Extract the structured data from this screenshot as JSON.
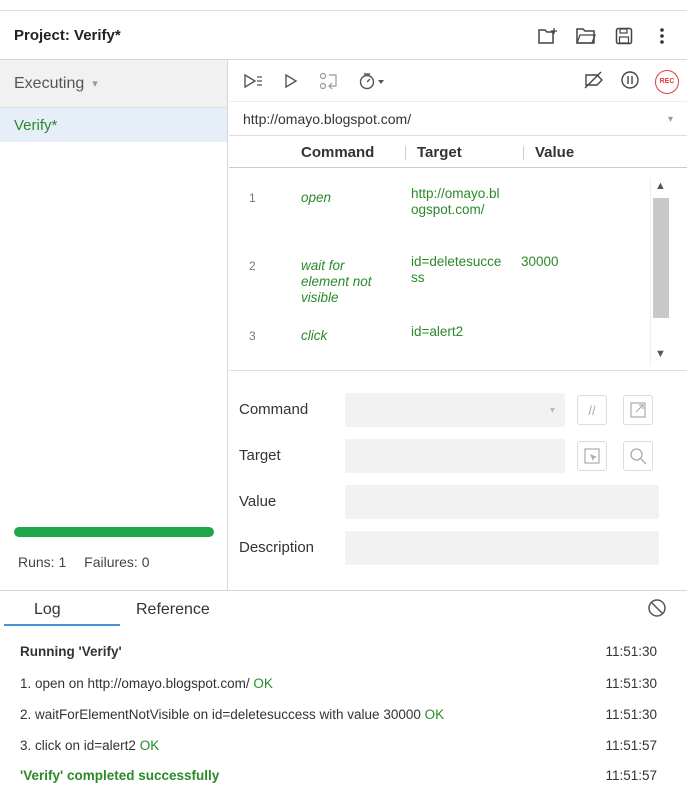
{
  "project": {
    "title": "Project: Verify*"
  },
  "header_icons": [
    "new-suite-icon",
    "open-folder-icon",
    "save-icon",
    "more-vertical-icon"
  ],
  "left_pane": {
    "mode_label": "Executing",
    "suite_item": "Verify*",
    "progress_percent": 100,
    "runs_label": "Runs: 1",
    "failures_label": "Failures: 0"
  },
  "toolbar": {
    "icons": [
      "run-all-icon",
      "run-current-icon",
      "step-icon",
      "speed-icon",
      "disable-breakpoints-icon",
      "pause-icon",
      "record-icon"
    ],
    "rec_label": "REC"
  },
  "url": {
    "value": "http://omayo.blogspot.com/"
  },
  "table": {
    "headers": {
      "command": "Command",
      "target": "Target",
      "value": "Value"
    },
    "rows": [
      {
        "num": "1",
        "command": "open",
        "target": "http://omayo.blogspot.com/",
        "value": ""
      },
      {
        "num": "2",
        "command": "wait for element not visible",
        "target": "id=deletesuccess",
        "value": "30000"
      },
      {
        "num": "3",
        "command": "click",
        "target": "id=alert2",
        "value": ""
      }
    ]
  },
  "editor": {
    "command_label": "Command",
    "target_label": "Target",
    "value_label": "Value",
    "description_label": "Description",
    "comment_btn": "//"
  },
  "log_tabs": {
    "log": "Log",
    "reference": "Reference"
  },
  "log": {
    "lines": [
      {
        "text": "Running 'Verify'",
        "ok": "",
        "time": "11:51:30"
      },
      {
        "text": "1.  open on http://omayo.blogspot.com/",
        "ok": "OK",
        "time": "11:51:30"
      },
      {
        "text": "2.  waitForElementNotVisible on id=deletesuccess with value 30000",
        "ok": "OK",
        "time": "11:51:30"
      },
      {
        "text": "3.  click on id=alert2",
        "ok": "OK",
        "time": "11:51:57"
      },
      {
        "text": "'Verify' completed successfully",
        "ok": "",
        "time": "11:51:57"
      }
    ]
  },
  "colors": {
    "accent_green": "#2a8a2a",
    "progress_green": "#1fa64a",
    "tab_blue": "#4a90d9",
    "rec_red": "#e23b3b"
  }
}
